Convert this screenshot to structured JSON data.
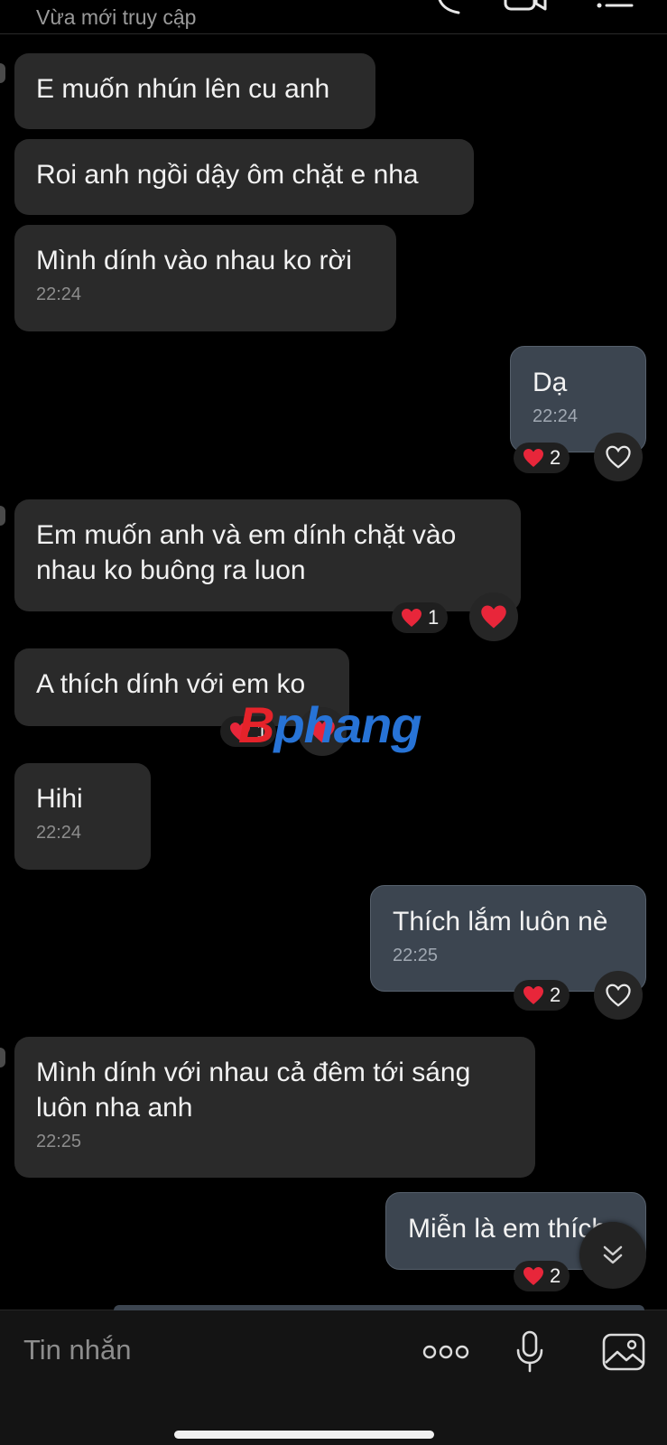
{
  "header": {
    "status": "Vừa mới truy cập",
    "icons": [
      "phone-icon",
      "video-call-icon",
      "menu-icon"
    ]
  },
  "messages": [
    {
      "dir": "in",
      "text": "E muốn nhún lên cu anh",
      "time": ""
    },
    {
      "dir": "in",
      "text": "Roi anh ngồi dậy ôm chặt e nha",
      "time": ""
    },
    {
      "dir": "in",
      "text": "Mình dính vào nhau ko rời",
      "time": "22:24"
    },
    {
      "dir": "out",
      "text": "Dạ",
      "time": "22:24",
      "reaction_count": "2"
    },
    {
      "dir": "in",
      "text": "Em muốn anh và em dính chặt vào\nnhau ko buông ra luon",
      "time": "",
      "reaction_count": "1"
    },
    {
      "dir": "in",
      "text": "A thích dính với em ko",
      "time": "",
      "reaction_count": "1"
    },
    {
      "dir": "in",
      "text": "Hihi",
      "time": "22:24"
    },
    {
      "dir": "out",
      "text": "Thích lắm luôn nè",
      "time": "22:25",
      "reaction_count": "2"
    },
    {
      "dir": "in",
      "text": "Mình dính với nhau cả đêm tới sáng\nluôn nha anh",
      "time": "22:25"
    },
    {
      "dir": "out",
      "text": "Miễn là em thích",
      "time": "",
      "reaction_count": "2"
    }
  ],
  "watermark": {
    "prefix": "B",
    "rest": "phang"
  },
  "composer": {
    "placeholder": "Tin nhắn",
    "icons": [
      "more-icon",
      "microphone-icon",
      "image-icon"
    ]
  },
  "colors": {
    "background": "#000000",
    "incoming_bubble": "#2a2a2a",
    "outgoing_bubble": "#3c4550",
    "heart": "#e8263a",
    "watermark_blue": "#2773d6",
    "watermark_red": "#e5232a"
  }
}
